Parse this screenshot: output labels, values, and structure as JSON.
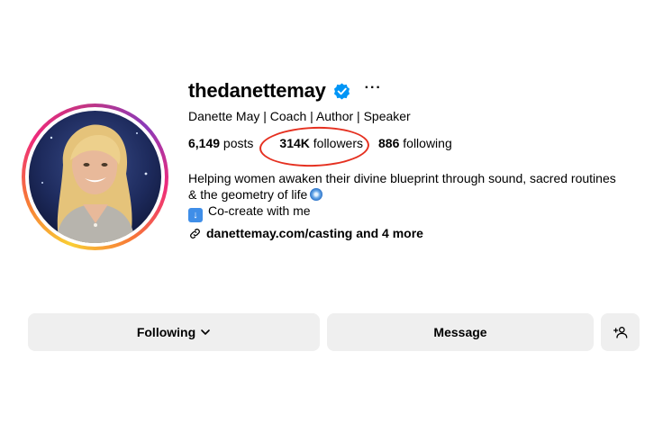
{
  "profile": {
    "username": "thedanettemay",
    "more_label": "···",
    "full_name": "Danette May | Coach | Author | Speaker",
    "verified_icon": "verified-badge-icon",
    "avatar_alt": "profile photo"
  },
  "stats": {
    "posts_count": "6,149",
    "posts_label": " posts",
    "followers_count": "314K",
    "followers_label": " followers",
    "following_count": "886",
    "following_label": " following"
  },
  "bio": {
    "line1": "Helping women awaken their divine blueprint through sound, sacred routines",
    "line2": "& the geometry of life",
    "line3": "Co-create with me"
  },
  "link": {
    "text": "danettemay.com/casting and 4 more"
  },
  "buttons": {
    "following_label": "Following",
    "message_label": "Message",
    "add_user_icon": "add-person-icon"
  },
  "colors": {
    "verified": "#0095f6",
    "button_bg": "#efefef",
    "annotation": "#e53020"
  }
}
